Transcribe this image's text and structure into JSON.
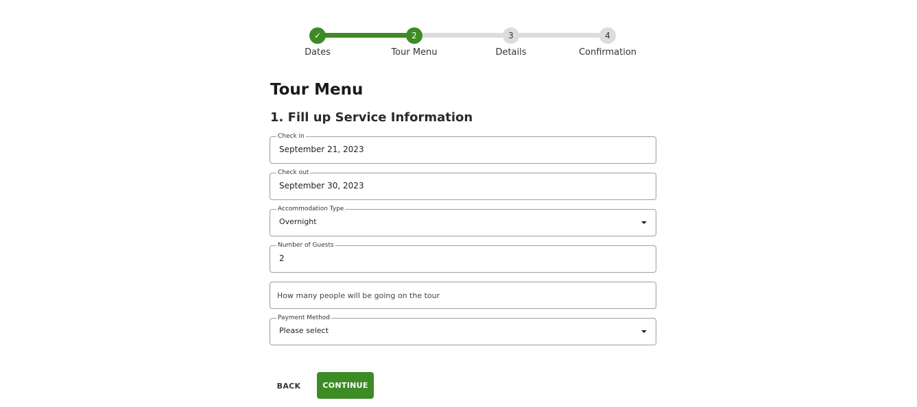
{
  "stepper": {
    "steps": [
      {
        "label": "Dates",
        "indicator": "✓",
        "state": "completed"
      },
      {
        "label": "Tour Menu",
        "indicator": "2",
        "state": "active"
      },
      {
        "label": "Details",
        "indicator": "3",
        "state": "pending"
      },
      {
        "label": "Confirmation",
        "indicator": "4",
        "state": "pending"
      }
    ]
  },
  "page": {
    "title": "Tour Menu",
    "section_title": "1. Fill up Service Information"
  },
  "form": {
    "check_in": {
      "label": "Check in",
      "value": "September 21, 2023"
    },
    "check_out": {
      "label": "Check out",
      "value": "September 30, 2023"
    },
    "accommodation_type": {
      "label": "Accommodation Type",
      "value": "Overnight"
    },
    "number_of_guests": {
      "label": "Number of Guests",
      "value": "2"
    },
    "guests_note": {
      "placeholder": "How many people will be going on the tour"
    },
    "payment_method": {
      "label": "Payment Method",
      "value": "Please select"
    }
  },
  "actions": {
    "back_label": "BACK",
    "continue_label": "CONTINUE"
  },
  "colors": {
    "accent": "#3d8b25",
    "inactive": "#dcdcdc",
    "border": "#9e9e9e"
  }
}
